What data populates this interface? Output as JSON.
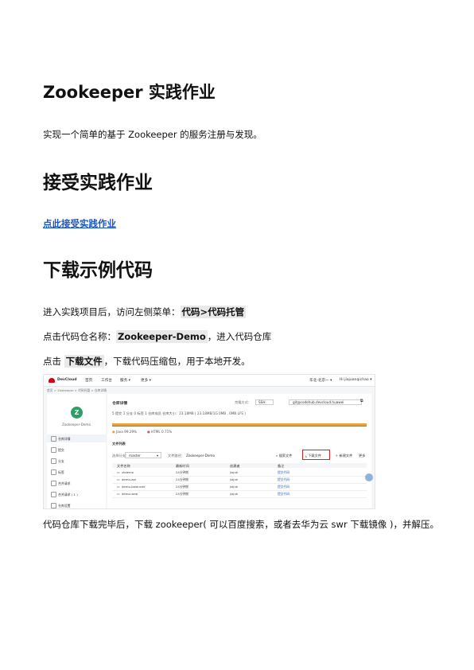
{
  "heading_title": "Zookeeper 实践作业",
  "intro": "实现一个简单的基于 Zookeeper 的服务注册与发现。",
  "heading_accept": "接受实践作业",
  "accept_link": "点此接受实践作业",
  "heading_download": "下载示例代码",
  "step1": {
    "before": "进入实践项目后，访问左侧菜单：",
    "highlight": "代码>代码托管"
  },
  "step2": {
    "before": "点击代码仓名称：",
    "highlight": "Zookeeper-Demo",
    "after": "，进入代码仓库"
  },
  "step3": {
    "before": "点击 ",
    "highlight": "下载文件",
    "after": "，下载代码压缩包，用于本地开发。"
  },
  "step4": "代码仓库下载完毕后，下载 zookeeper( 可以百度搜索，或者去华为云 swr 下载镜像 )，并解压。",
  "screenshot": {
    "topbar": {
      "brand": "DevCloud",
      "nav": [
        "首页",
        "工作台",
        "服务 ▾",
        "更多 ▾"
      ],
      "user": "Hi jiajuanqichao ▾",
      "org": "华北-北京一 ▾"
    },
    "breadcrumb": "首页 > Zookeeper > 代码托管 > 仓库详情",
    "repo_name": "Zookeeper-Demo",
    "avatar_letter": "Z",
    "side_items": [
      "仓库详情",
      "提交",
      "分支",
      "标签",
      "合并请求",
      "合并请求 ( 1 )",
      "仓库设置"
    ],
    "main_title": "仓库详情",
    "clone_label": "克隆方式：",
    "clone_type": "SSH",
    "clone_url": "git@codehub.devcloud.huawei",
    "stats": "5 提交    1 分支    0 标签    1 仓库成员    仓库大小：23.18MB ( 23.18MB/1G 0MB , 0MB LFS )",
    "languages": [
      "Java 99.29%",
      "HTML 0.71%"
    ],
    "file_list_title": "文件列表",
    "branch_label": "选择分支：",
    "branch": "master",
    "path_label": "文件路径：",
    "path": "Zookeeper-Demo",
    "actions": [
      "搜索文件",
      "下载文件",
      "新建文件",
      "更多"
    ],
    "columns": [
      "文件名称",
      "最新时间",
      "创建者",
      "备注"
    ],
    "rows": [
      [
        "zkdemo",
        "24分钟前",
        "jiajuh",
        "提交代码"
      ],
      [
        "demo-api",
        "24分钟前",
        "jiajuh",
        "提交代码"
      ],
      [
        "demo-balanced",
        "24分钟前",
        "jiajuh",
        "提交代码"
      ],
      [
        "demo-web",
        "24分钟前",
        "jiajuh",
        "提交代码"
      ]
    ],
    "colors": {
      "accent_red": "#e02020",
      "brand_red": "#d7000f",
      "link": "#1a56c4",
      "avatar": "#2e9e67"
    }
  }
}
